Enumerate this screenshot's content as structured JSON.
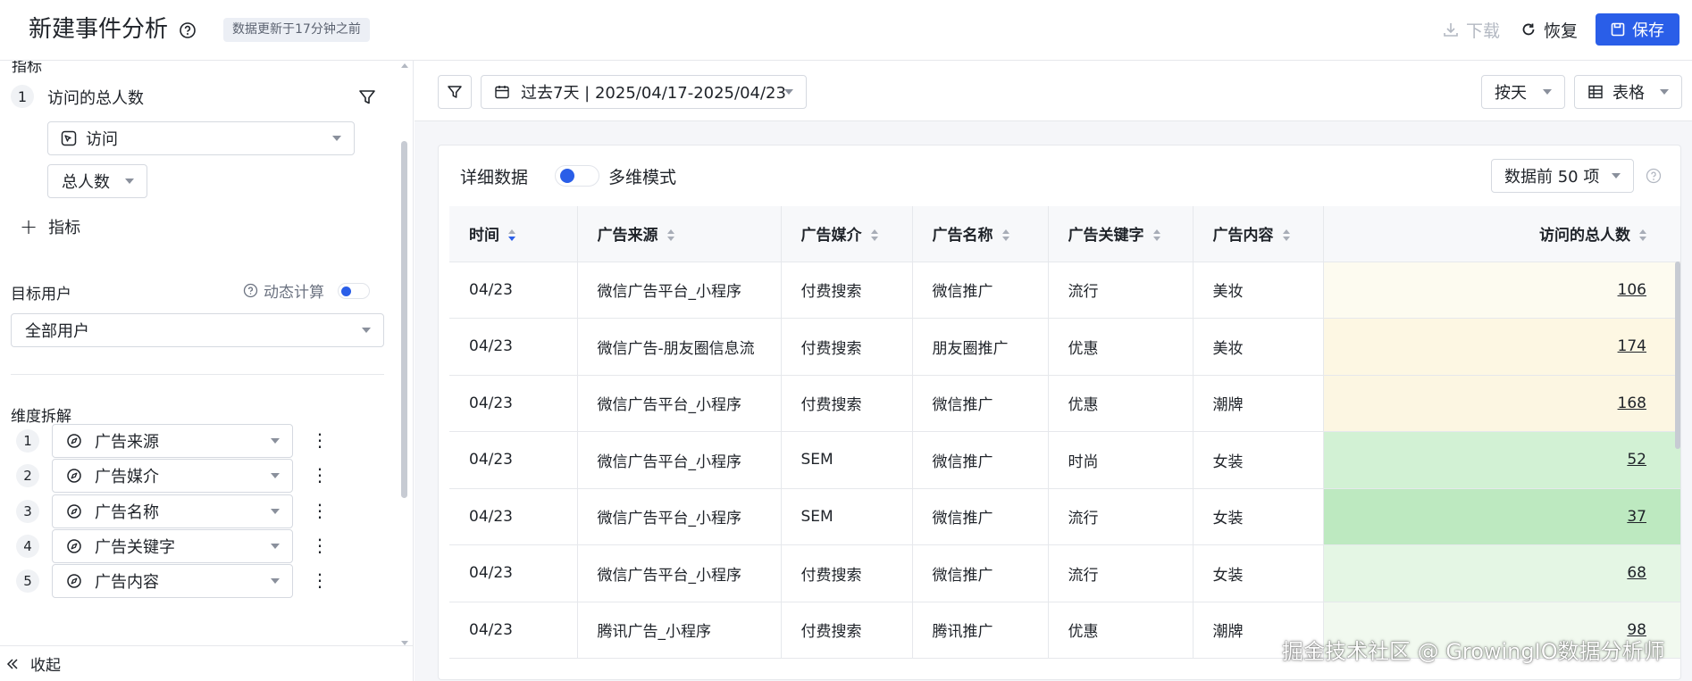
{
  "header": {
    "title": "新建事件分析",
    "update_badge": "数据更新于17分钟之前",
    "download_label": "下载",
    "restore_label": "恢复",
    "save_label": "保存"
  },
  "sidebar": {
    "clipped_section_title": "指标",
    "metric": {
      "index": "1",
      "name": "访问的总人数",
      "event": "访问",
      "aggregation": "总人数"
    },
    "add_metric_label": "指标",
    "target_users_label": "目标用户",
    "dynamic_calc_label": "动态计算",
    "dynamic_calc_on": true,
    "target_users_value": "全部用户",
    "dimension_label": "维度拆解",
    "dimensions": [
      {
        "index": "1",
        "label": "广告来源"
      },
      {
        "index": "2",
        "label": "广告媒介"
      },
      {
        "index": "3",
        "label": "广告名称"
      },
      {
        "index": "4",
        "label": "广告关键字"
      },
      {
        "index": "5",
        "label": "广告内容"
      }
    ],
    "collapse_label": "收起"
  },
  "toolbar": {
    "date_range": "过去7天 | 2025/04/17-2025/04/23",
    "granularity": "按天",
    "view_mode": "表格"
  },
  "card": {
    "title": "详细数据",
    "multi_dim_label": "多维模式",
    "multi_dim_on": true,
    "top_n": "数据前 50 项"
  },
  "table": {
    "columns": [
      "时间",
      "广告来源",
      "广告媒介",
      "广告名称",
      "广告关键字",
      "广告内容",
      "访问的总人数"
    ],
    "rows": [
      [
        "04/23",
        "微信广告平台_小程序",
        "付费搜索",
        "微信推广",
        "流行",
        "美妆",
        "106"
      ],
      [
        "04/23",
        "微信广告-朋友圈信息流",
        "付费搜索",
        "朋友圈推广",
        "优惠",
        "美妆",
        "174"
      ],
      [
        "04/23",
        "微信广告平台_小程序",
        "付费搜索",
        "微信推广",
        "优惠",
        "潮牌",
        "168"
      ],
      [
        "04/23",
        "微信广告平台_小程序",
        "SEM",
        "微信推广",
        "时尚",
        "女装",
        "52"
      ],
      [
        "04/23",
        "微信广告平台_小程序",
        "SEM",
        "微信推广",
        "流行",
        "女装",
        "37"
      ],
      [
        "04/23",
        "微信广告平台_小程序",
        "付费搜索",
        "微信推广",
        "流行",
        "女装",
        "68"
      ],
      [
        "04/23",
        "腾讯广告_小程序",
        "付费搜索",
        "腾讯推广",
        "优惠",
        "潮牌",
        "98"
      ]
    ],
    "heat_colors": [
      "#fdfbf0",
      "#fdf7e3",
      "#fcf6e2",
      "#d2f1d4",
      "#bde9c0",
      "#e4f6e4",
      "#f1f9ef"
    ]
  },
  "colors": {
    "accent": "#2a5ee8"
  },
  "watermark": "掘金技术社区 @ GrowingIO数据分析师"
}
